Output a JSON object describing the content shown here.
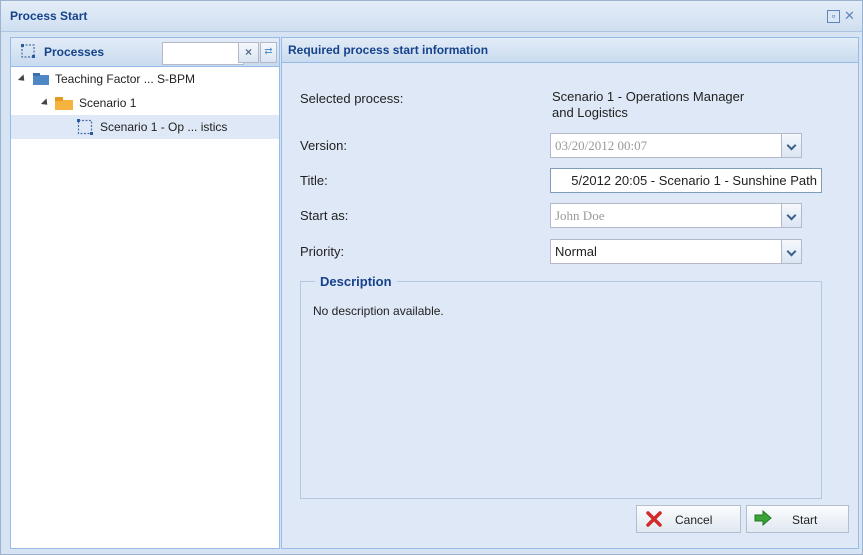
{
  "window": {
    "title": "Process Start",
    "controls": [
      "restore-icon",
      "close-icon"
    ]
  },
  "left": {
    "header": "Processes",
    "filter_value": "",
    "tree": [
      {
        "label": "Teaching Factor ... S-BPM",
        "icon": "category-icon",
        "level": 0
      },
      {
        "label": "Scenario 1",
        "icon": "folder-icon",
        "level": 1
      },
      {
        "label": "Scenario 1 - Op ... istics",
        "icon": "process-icon",
        "level": 2,
        "selected": true
      }
    ]
  },
  "right": {
    "header": "Required process start information",
    "fields": {
      "selected_process_label": "Selected process:",
      "selected_process_value": "Scenario 1 - Operations Manager and Logistics",
      "selected_process_line1": "Scenario 1 - Operations Manager",
      "selected_process_line2": "and Logistics",
      "version_label": "Version:",
      "version_value": "03/20/2012 00:07",
      "title_label": "Title:",
      "title_value": "5/2012 20:05 - Scenario 1 - Sunshine Path",
      "start_as_label": "Start as:",
      "start_as_value": "John Doe",
      "priority_label": "Priority:",
      "priority_value": "Normal"
    },
    "description": {
      "legend": "Description",
      "text": "No description available."
    },
    "buttons": {
      "cancel": "Cancel",
      "start": "Start"
    }
  },
  "colors": {
    "title_blue": "#15428b",
    "panel_bg": "#dfe8f6",
    "border": "#99bbe8"
  }
}
